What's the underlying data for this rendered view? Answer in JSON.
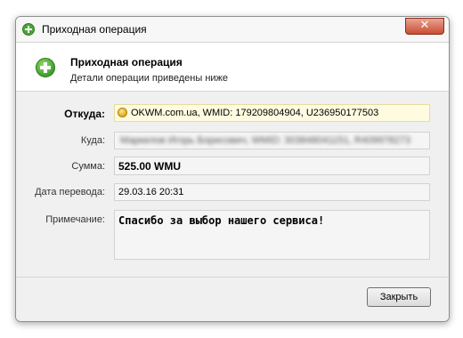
{
  "window": {
    "title": "Приходная операция",
    "close_glyph": "✕"
  },
  "header": {
    "title": "Приходная операция",
    "subtitle": "Детали операции приведены ниже",
    "icon": "plus-circle-icon"
  },
  "fields": {
    "from_label": "Откуда:",
    "from_value": "OKWM.com.ua, WMID: 179209804904, U236950177503",
    "to_label": "Куда:",
    "to_value": "Маркелов Игорь Борисович, WMID: 303848041151, R409978273",
    "amount_label": "Сумма:",
    "amount_value": "525.00 WMU",
    "date_label": "Дата перевода:",
    "date_value": "29.03.16 20:31",
    "note_label": "Примечание:",
    "note_value": "Спасибо за выбор нашего сервиса!"
  },
  "footer": {
    "close_label": "Закрыть"
  },
  "colors": {
    "accent_green": "#4aa53a",
    "close_red": "#c94f33",
    "highlight": "#fffbe0"
  }
}
